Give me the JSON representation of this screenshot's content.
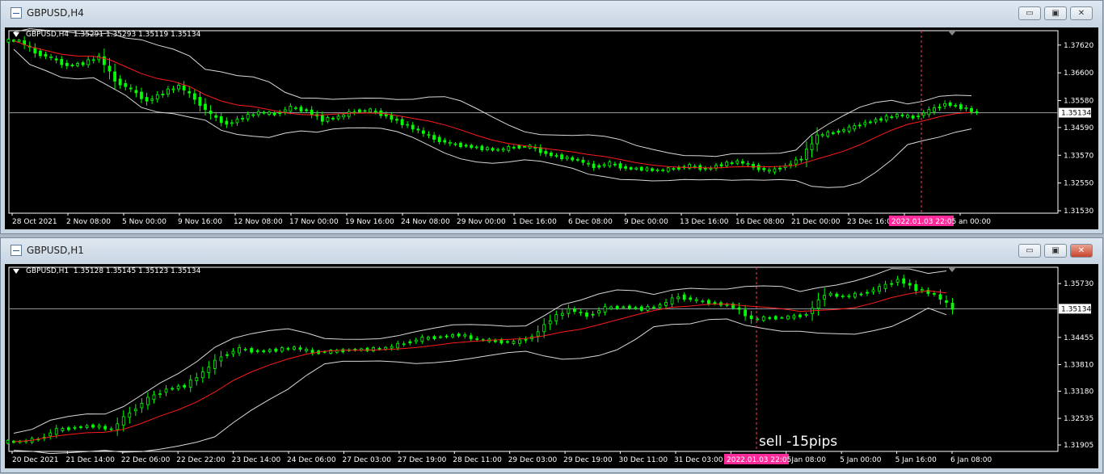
{
  "windows": [
    {
      "title": "GBPUSD,H4",
      "header_symbol": "GBPUSD,H4",
      "ohlc": "1.35291 1.35293 1.35119 1.35134",
      "current_price": "1.35134",
      "price_labels": [
        "1.37620",
        "1.36600",
        "1.35580",
        "1.34590",
        "1.33570",
        "1.32550",
        "1.31530"
      ],
      "time_labels": [
        "28 Oct 2021",
        "2 Nov 08:00",
        "5 Nov 00:00",
        "9 Nov 16:00",
        "12 Nov 08:00",
        "17 Nov 00:00",
        "19 Nov 16:00",
        "24 Nov 08:00",
        "29 Nov 00:00",
        "1 Dec 16:00",
        "6 Dec 08:00",
        "9 Dec 00:00",
        "13 Dec 16:00",
        "16 Dec 08:00",
        "21 Dec 00:00",
        "23 Dec 16:00",
        "28 Dec 12:00",
        "an 00:00"
      ],
      "marker_label": "2022.01.03 22:05",
      "annotation": "",
      "y_range": [
        1.3153,
        1.3806
      ]
    },
    {
      "title": "GBPUSD,H1",
      "header_symbol": "GBPUSD,H1",
      "ohlc": "1.35128 1.35145 1.35123 1.35134",
      "current_price": "1.35134",
      "price_labels": [
        "1.35730",
        "1.34455",
        "1.33810",
        "1.33180",
        "1.32535",
        "1.31905"
      ],
      "time_labels": [
        "20 Dec 2021",
        "21 Dec 14:00",
        "22 Dec 06:00",
        "22 Dec 22:00",
        "23 Dec 14:00",
        "24 Dec 06:00",
        "27 Dec 03:00",
        "27 Dec 19:00",
        "28 Dec 11:00",
        "29 Dec 03:00",
        "29 Dec 19:00",
        "30 Dec 11:00",
        "31 Dec 03:00",
        "3 Jan 00:00",
        "4 Jan 08:00",
        "5 Jan 00:00",
        "5 Jan 16:00",
        "6 Jan 08:00"
      ],
      "marker_label": "2022.01.03 22:05",
      "annotation": "sell -15pips",
      "y_range": [
        1.3181,
        1.3606
      ]
    }
  ],
  "window_controls": {
    "minimize": "▭",
    "restore": "▣",
    "close": "✕"
  },
  "chart_data": [
    {
      "type": "candlestick",
      "title": "GBPUSD,H4",
      "y_ticks": [
        1.3762,
        1.366,
        1.3558,
        1.3459,
        1.3357,
        1.3255,
        1.3153
      ],
      "current": 1.35134,
      "close_path": [
        1.3778,
        1.3735,
        1.3714,
        1.3686,
        1.3695,
        1.3719,
        1.3632,
        1.3598,
        1.3556,
        1.3587,
        1.3612,
        1.3565,
        1.3505,
        1.3471,
        1.3496,
        1.3515,
        1.3508,
        1.3532,
        1.3521,
        1.3487,
        1.3498,
        1.3519,
        1.3522,
        1.3501,
        1.3474,
        1.3447,
        1.3418,
        1.3399,
        1.3391,
        1.3382,
        1.3376,
        1.3388,
        1.3389,
        1.3363,
        1.3349,
        1.3339,
        1.3314,
        1.3327,
        1.3309,
        1.3307,
        1.3301,
        1.3308,
        1.3318,
        1.3306,
        1.3323,
        1.3334,
        1.3315,
        1.3298,
        1.3318,
        1.3347,
        1.3429,
        1.3441,
        1.3456,
        1.3477,
        1.3491,
        1.3505,
        1.3496,
        1.352,
        1.3547,
        1.3533,
        1.3513
      ]
    },
    {
      "type": "candlestick",
      "title": "GBPUSD,H1",
      "y_ticks": [
        1.3573,
        1.34455,
        1.3381,
        1.3318,
        1.32535,
        1.31905
      ],
      "current": 1.35134,
      "annotation": "sell -15pips",
      "close_path": [
        1.3198,
        1.3205,
        1.3226,
        1.3232,
        1.3236,
        1.3227,
        1.3268,
        1.33,
        1.3323,
        1.3331,
        1.3362,
        1.3401,
        1.3418,
        1.3412,
        1.3416,
        1.3421,
        1.341,
        1.3412,
        1.3416,
        1.3417,
        1.342,
        1.3432,
        1.3443,
        1.3447,
        1.3452,
        1.344,
        1.3437,
        1.3433,
        1.3447,
        1.3488,
        1.3512,
        1.3497,
        1.3515,
        1.3518,
        1.3513,
        1.3521,
        1.3543,
        1.3532,
        1.3526,
        1.3519,
        1.3488,
        1.3492,
        1.3493,
        1.35,
        1.3549,
        1.3542,
        1.3549,
        1.3563,
        1.3583,
        1.356,
        1.3547,
        1.3514
      ]
    }
  ]
}
